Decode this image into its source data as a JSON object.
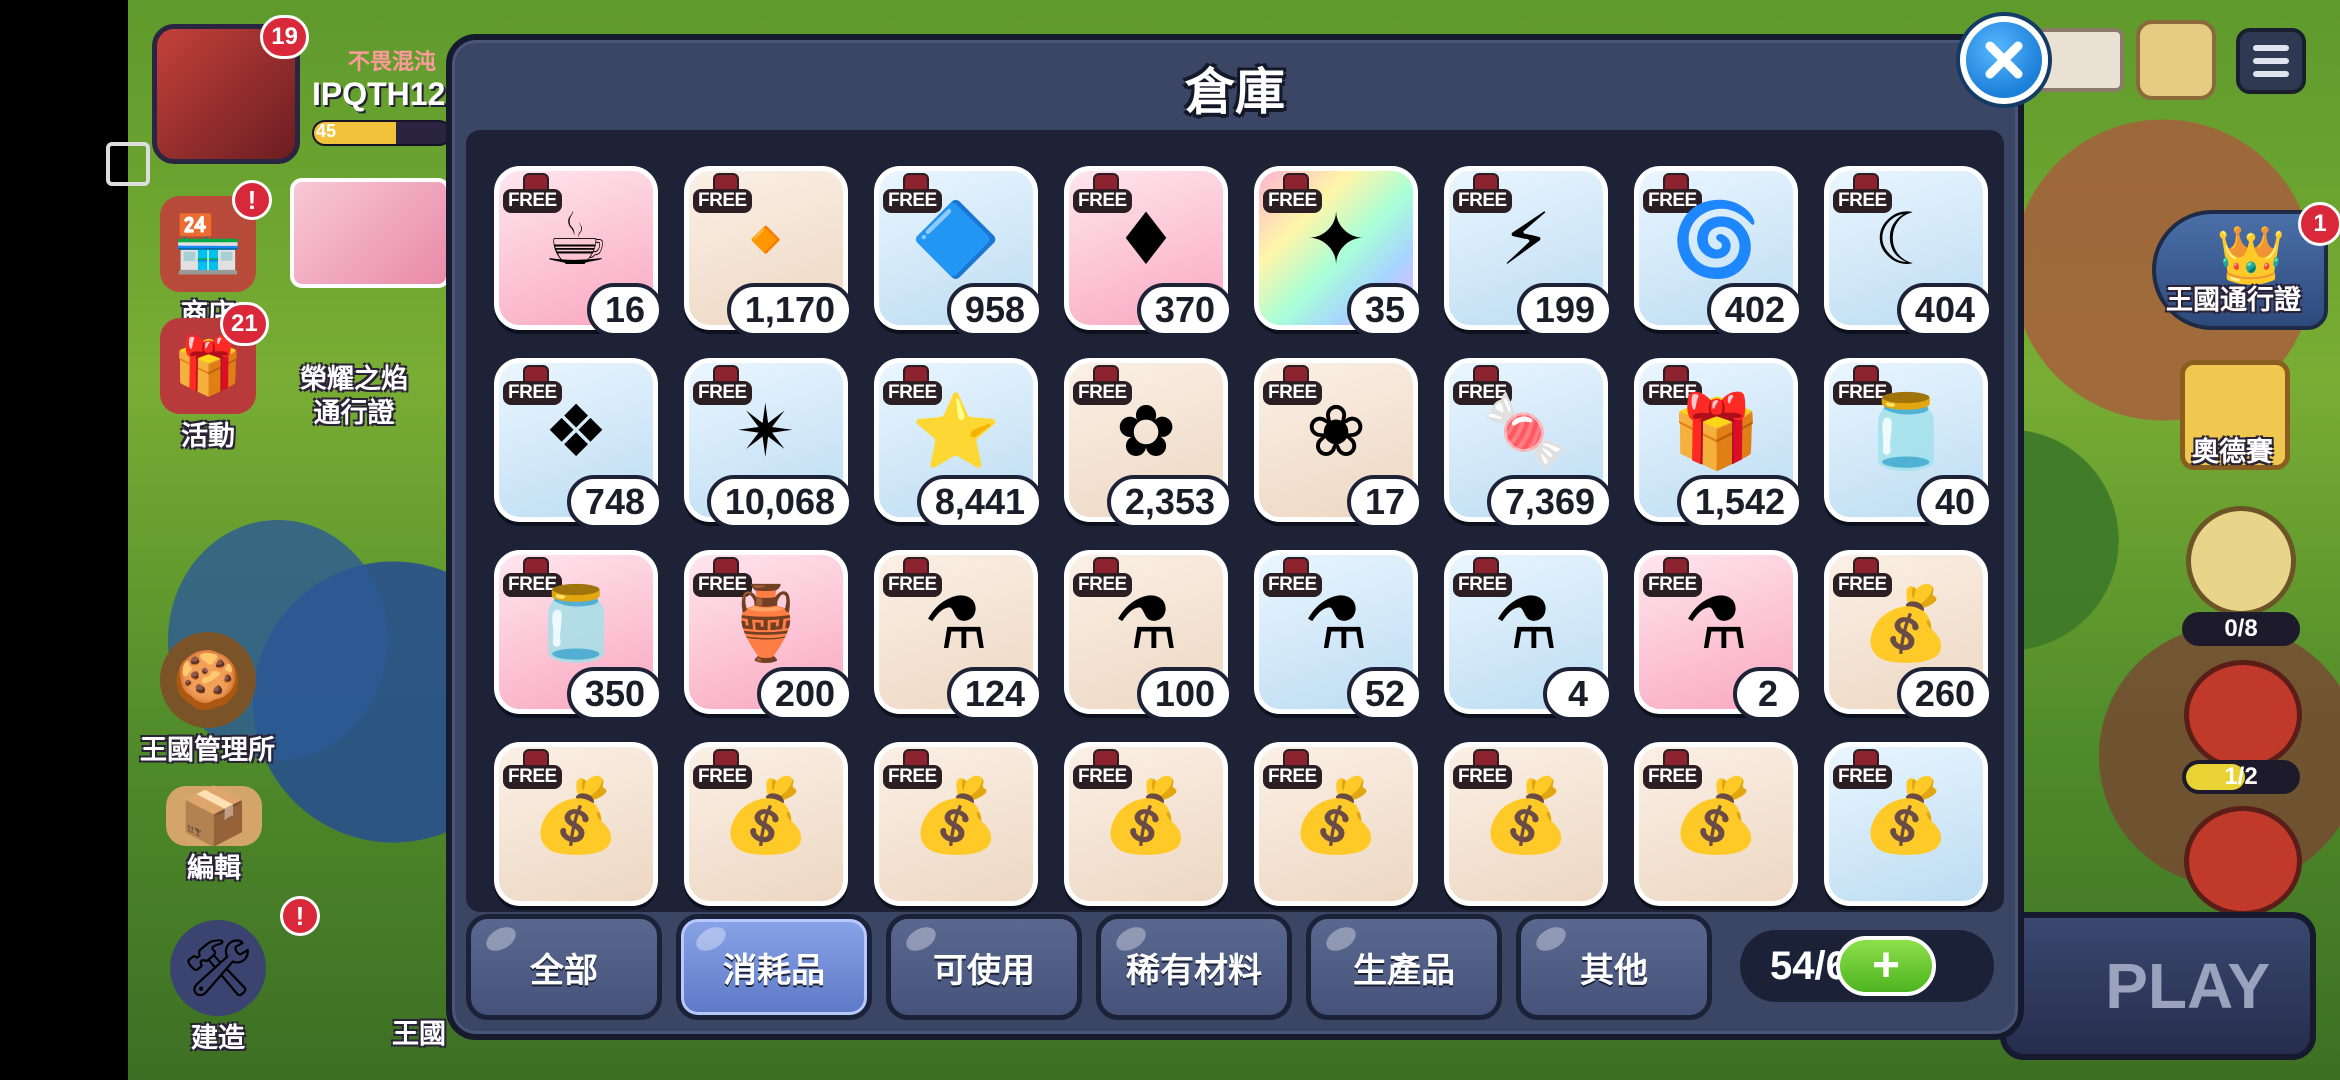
{
  "player": {
    "badge": "19",
    "title": "不畏混沌",
    "name": "IPQTH12",
    "level": "45",
    "exp_fraction": 0.6
  },
  "left_menu": {
    "shop": {
      "label": "商店",
      "badge": "!"
    },
    "event": {
      "label": "活動",
      "badge": "21"
    },
    "honor_pass": {
      "label": "榮耀之焰\n通行證"
    },
    "kingdom_office": {
      "label": "王國管理所"
    },
    "edit": {
      "label": "編輯"
    },
    "build": {
      "label": "建造",
      "badge": "!"
    },
    "kingdom_more": {
      "label": "王國"
    }
  },
  "right_menu": {
    "kingdom_pass": {
      "label": "王國通行證",
      "badge": "1"
    },
    "odd_race": {
      "label": "奧德賽"
    },
    "box_count": "0/8",
    "house_count": "1/2",
    "play": "PLAY"
  },
  "inventory": {
    "title": "倉庫",
    "free_label": "FREE",
    "items": [
      {
        "icon": "coffee-cup-icon",
        "glyph": "☕",
        "bg": "pink",
        "count": "16"
      },
      {
        "icon": "brown-crystal-icon",
        "glyph": "🔸",
        "bg": "cream",
        "count": "1,170"
      },
      {
        "icon": "blue-crystal-icon",
        "glyph": "🔷",
        "bg": "blue",
        "count": "958"
      },
      {
        "icon": "red-crystal-icon",
        "glyph": "♦",
        "bg": "pink",
        "count": "370"
      },
      {
        "icon": "rainbow-crystal-icon",
        "glyph": "✦",
        "bg": "rainbow",
        "count": "35"
      },
      {
        "icon": "red-cube-icon",
        "glyph": "⚡",
        "bg": "blue",
        "count": "199"
      },
      {
        "icon": "blue-cube-icon",
        "glyph": "🌀",
        "bg": "blue",
        "count": "402"
      },
      {
        "icon": "purple-cube-icon",
        "glyph": "☾",
        "bg": "blue",
        "count": "404"
      },
      {
        "icon": "white-cube-icon",
        "glyph": "❖",
        "bg": "blue",
        "count": "748"
      },
      {
        "icon": "star-shard-icon",
        "glyph": "✴",
        "bg": "blue",
        "count": "10,068"
      },
      {
        "icon": "star-tile-icon",
        "glyph": "⭐",
        "bg": "blue",
        "count": "8,441"
      },
      {
        "icon": "mint-jelly-icon",
        "glyph": "✿",
        "bg": "cream",
        "count": "2,353"
      },
      {
        "icon": "color-jellies-icon",
        "glyph": "❀",
        "bg": "cream",
        "count": "17"
      },
      {
        "icon": "jelly-candy-icon",
        "glyph": "🍬",
        "bg": "blue",
        "count": "7,369"
      },
      {
        "icon": "jelly-bag-icon",
        "glyph": "🎁",
        "bg": "blue",
        "count": "1,542"
      },
      {
        "icon": "jelly-jar-star-icon",
        "glyph": "🫙",
        "bg": "blue",
        "count": "40"
      },
      {
        "icon": "jelly-jar-icon",
        "glyph": "🫙",
        "bg": "pink",
        "count": "350"
      },
      {
        "icon": "big-jelly-jar-icon",
        "glyph": "🏺",
        "bg": "pink",
        "count": "200"
      },
      {
        "icon": "small-blue-potion-icon",
        "glyph": "⚗",
        "bg": "cream",
        "count": "124"
      },
      {
        "icon": "blue-potion-icon",
        "glyph": "⚗",
        "bg": "cream",
        "count": "100"
      },
      {
        "icon": "winged-potion-icon",
        "glyph": "⚗",
        "bg": "blue",
        "count": "52"
      },
      {
        "icon": "dark-winged-potion-icon",
        "glyph": "⚗",
        "bg": "blue",
        "count": "4"
      },
      {
        "icon": "large-winged-potion-icon",
        "glyph": "⚗",
        "bg": "pink",
        "count": "2"
      },
      {
        "icon": "fist-sack-icon",
        "glyph": "💰",
        "bg": "cream",
        "count": "260"
      },
      {
        "icon": "shield-sack-icon",
        "glyph": "💰",
        "bg": "cream",
        "count": ""
      },
      {
        "icon": "star-sack-icon",
        "glyph": "💰",
        "bg": "cream",
        "count": ""
      },
      {
        "icon": "sword-sack-icon",
        "glyph": "💰",
        "bg": "cream",
        "count": ""
      },
      {
        "icon": "cross-sack-icon",
        "glyph": "💰",
        "bg": "cream",
        "count": ""
      },
      {
        "icon": "bomb-sack-icon",
        "glyph": "💰",
        "bg": "cream",
        "count": ""
      },
      {
        "icon": "chevron-sack-icon",
        "glyph": "💰",
        "bg": "cream",
        "count": ""
      },
      {
        "icon": "arrow-sack-icon",
        "glyph": "💰",
        "bg": "cream",
        "count": ""
      },
      {
        "icon": "blue-fist-sack-icon",
        "glyph": "💰",
        "bg": "blue",
        "count": ""
      }
    ],
    "tabs": [
      {
        "label": "全部",
        "active": false
      },
      {
        "label": "消耗品",
        "active": true
      },
      {
        "label": "可使用",
        "active": false
      },
      {
        "label": "稀有材料",
        "active": false
      },
      {
        "label": "生產品",
        "active": false
      },
      {
        "label": "其他",
        "active": false
      }
    ],
    "capacity": "54/63",
    "add_symbol": "+"
  },
  "colors": {
    "modal_bg": "#3b4564",
    "grid_bg": "#1d2236",
    "active_tab": "#5d78c6",
    "close_blue": "#1c7fd8",
    "add_green": "#4eb421"
  }
}
